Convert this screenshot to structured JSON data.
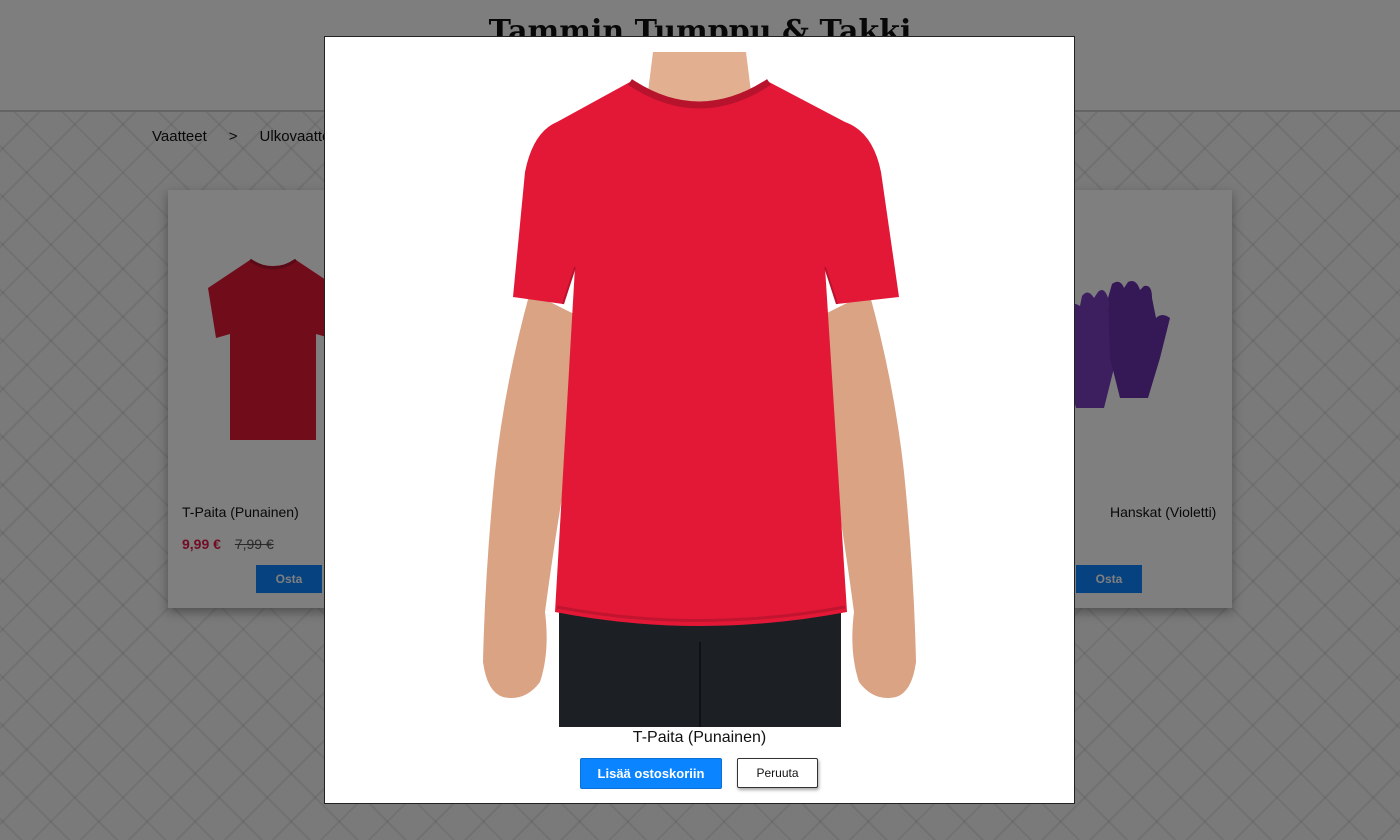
{
  "site": {
    "title": "Tammin Tumppu & Takki"
  },
  "breadcrumb": [
    "Vaatteet",
    ">",
    "Ulkovaatteet"
  ],
  "products": [
    {
      "name": "T-Paita (Punainen)",
      "price": "9,99 €",
      "old_price": "7,99 €",
      "buy_label": "Osta"
    },
    {
      "name": "Hanskat (Violetti)",
      "buy_label": "Osta"
    }
  ],
  "modal": {
    "caption": "T-Paita (Punainen)",
    "add_to_cart_label": "Lisää ostoskoriin",
    "cancel_label": "Peruuta"
  },
  "colors": {
    "primary_button": "#0b84ff",
    "sale_price": "#e6194b",
    "shirt": "#e31837",
    "gloves": "#7b3fbf"
  }
}
